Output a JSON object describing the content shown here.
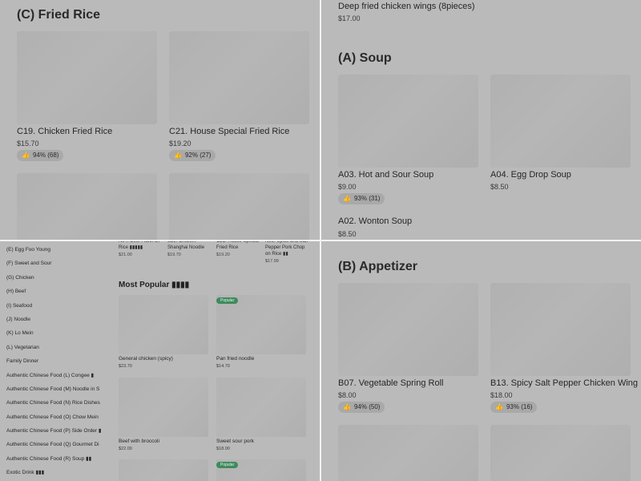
{
  "fried_rice": {
    "title": "(C) Fried Rice",
    "items": [
      {
        "name": "C19. Chicken Fried Rice",
        "price": "$15.70",
        "rating": "94% (68)"
      },
      {
        "name": "C21. House Special Fried Rice",
        "price": "$19.20",
        "rating": "92% (27)"
      }
    ]
  },
  "soup_panel": {
    "prev_item": {
      "name": "Deep fried chicken wings (8pieces)",
      "price": "$17.00"
    },
    "title": "(A) Soup",
    "items": [
      {
        "name": "A03. Hot and Sour Soup",
        "price": "$9.00",
        "rating": "93% (31)"
      },
      {
        "name": "A04. Egg Drop Soup",
        "price": "$8.50"
      },
      {
        "name": "A02. Wonton Soup",
        "price": "$8.50"
      }
    ]
  },
  "sidebar": {
    "categories": [
      "(E) Egg Foo Young",
      "(F) Sweet and Sour",
      "(G) Chicken",
      "(H) Beef",
      "(I) Seafood",
      "(J) Noodle",
      "(K) Lo Mein",
      "(L) Vegetarian",
      "Family Dinner",
      "Authentic Chinese Food (L) Congee ▮",
      "Authentic Chinese Food (M) Noodle in S",
      "Authentic Chinese Food (N) Rice Dishes",
      "Authentic Chinese Food (O) Chow Mein",
      "Authentic Chinese Food (P) Side Order ▮",
      "Authentic Chinese Food (Q) Gourmet Di",
      "Authentic Chinese Food (R) Soup ▮▮",
      "Exotic Drink ▮▮▮"
    ]
  },
  "mini_top_items": [
    {
      "name": "N04. Beef Flank on Rice ▮▮▮▮▮",
      "price": "$21.00"
    },
    {
      "name": "S39. Chicken Shanghai Noodle",
      "price": "$19.70"
    },
    {
      "name": "C21. House Special Fried Rice",
      "price": "$19.20"
    },
    {
      "name": "N99. Spice and Salt Pepper Pork Chop on Rice ▮▮",
      "price": "$17.99"
    }
  ],
  "most_popular": {
    "title": "Most Popular ▮▮▮▮",
    "badge": "Popular",
    "items": [
      {
        "name": "General chicken (spicy)",
        "price": "$23.70"
      },
      {
        "name": "Pan fried noodle",
        "price": "$14.70"
      },
      {
        "name": "Beef with broccoli",
        "price": "$22.00"
      },
      {
        "name": "Sweet sour pork",
        "price": "$18.00"
      }
    ]
  },
  "appetizer": {
    "title": "(B) Appetizer",
    "items": [
      {
        "name": "B07. Vegetable Spring Roll",
        "price": "$8.00",
        "rating": "94% (50)"
      },
      {
        "name": "B13. Spicy Salt Pepper Chicken Wing",
        "price": "$18.00",
        "rating": "93% (16)"
      }
    ]
  },
  "icons": {
    "rating": "thumbs-up-icon"
  }
}
